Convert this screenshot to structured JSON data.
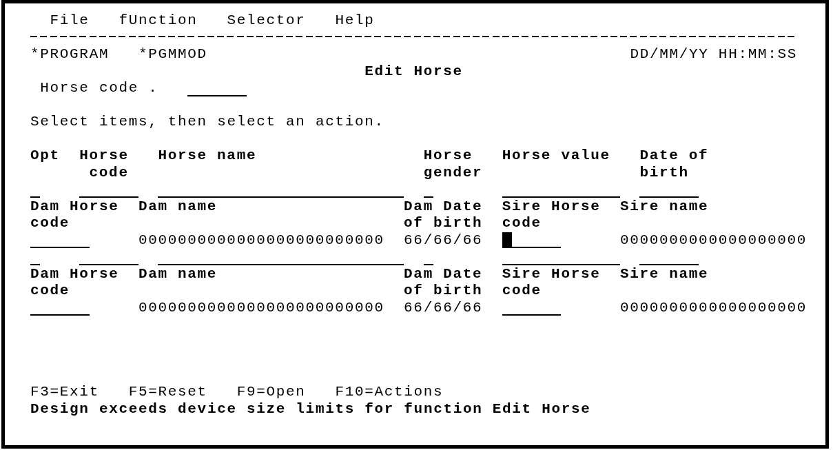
{
  "menu_bar": [
    "File",
    "fUnction",
    "Selector",
    "Help"
  ],
  "header": {
    "program": "*PROGRAM",
    "module": "*PGMMOD",
    "date_time": "DD/MM/YY HH:MM:SS",
    "title": "Edit Horse"
  },
  "position_to": {
    "label": "Horse code .",
    "focused": false
  },
  "instruction": "Select items, then select an action.",
  "subfile": {
    "columns": [
      "Opt",
      "Horse code",
      "Horse name",
      "Horse gender",
      "Horse value",
      "Date of birth"
    ],
    "rows": [
      {
        "column_fields": [
          {
            "focused": false
          },
          {
            "focused": false
          },
          {
            "focused": false
          },
          {
            "focused": false
          },
          {
            "focused": false
          },
          {
            "focused": false
          }
        ],
        "details": [
          {
            "kind": "field",
            "label": "Dam Horse code",
            "focused": false
          },
          {
            "kind": "value",
            "label": "Dam name",
            "value": "0000000000000000000000000"
          },
          {
            "kind": "value",
            "label": "Dam Date of birth",
            "value": "66/66/66"
          },
          {
            "kind": "field",
            "label": "Sire Horse code",
            "focused": true
          },
          {
            "kind": "value",
            "label": "Sire name",
            "value": "0000000000000000000"
          }
        ]
      },
      {
        "column_fields": [
          {
            "focused": false
          },
          {
            "focused": false
          },
          {
            "focused": false
          },
          {
            "focused": false
          },
          {
            "focused": false
          },
          {
            "focused": false
          }
        ],
        "details": [
          {
            "kind": "field",
            "label": "Dam Horse code",
            "focused": false
          },
          {
            "kind": "value",
            "label": "Dam name",
            "value": "0000000000000000000000000"
          },
          {
            "kind": "value",
            "label": "Dam Date of birth",
            "value": "66/66/66"
          },
          {
            "kind": "field",
            "label": "Sire Horse code",
            "focused": false
          },
          {
            "kind": "value",
            "label": "Sire name",
            "value": "0000000000000000000"
          }
        ]
      }
    ]
  },
  "function_keys": [
    "F3=Exit",
    "F5=Reset",
    "F9=Open",
    "F10=Actions"
  ],
  "message": "Design exceeds device size limits for function Edit Horse"
}
